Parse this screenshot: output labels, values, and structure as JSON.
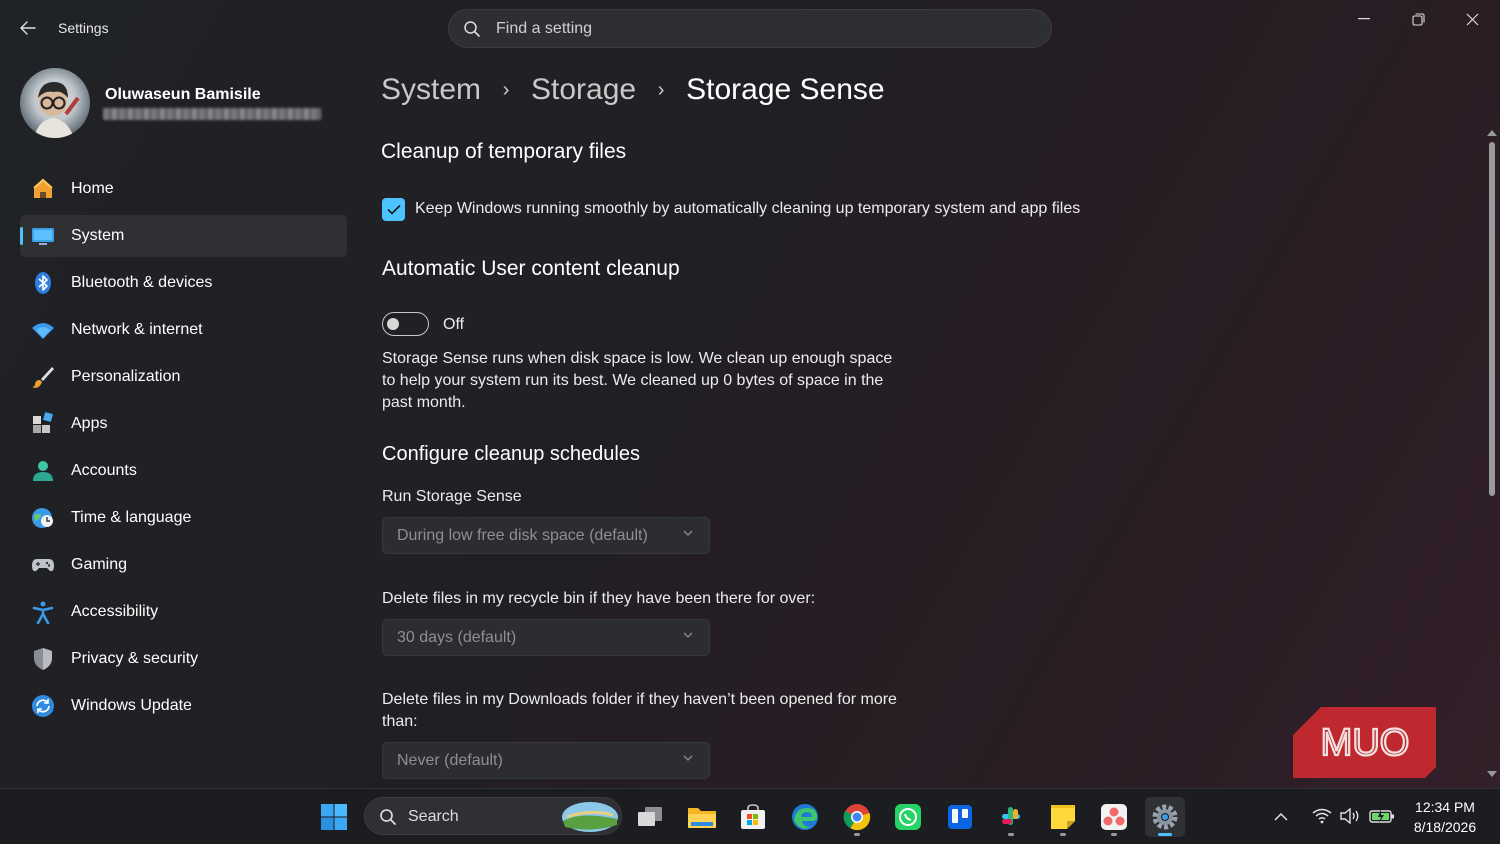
{
  "app": {
    "title": "Settings",
    "search_placeholder": "Find a setting"
  },
  "profile": {
    "name": "Oluwaseun Bamisile"
  },
  "sidebar": {
    "items": [
      {
        "label": "Home",
        "icon": "home-icon"
      },
      {
        "label": "System",
        "icon": "system-icon",
        "active": true
      },
      {
        "label": "Bluetooth & devices",
        "icon": "bluetooth-icon"
      },
      {
        "label": "Network & internet",
        "icon": "wifi-icon"
      },
      {
        "label": "Personalization",
        "icon": "brush-icon"
      },
      {
        "label": "Apps",
        "icon": "apps-icon"
      },
      {
        "label": "Accounts",
        "icon": "account-icon"
      },
      {
        "label": "Time & language",
        "icon": "globe-clock-icon"
      },
      {
        "label": "Gaming",
        "icon": "gamepad-icon"
      },
      {
        "label": "Accessibility",
        "icon": "accessibility-icon"
      },
      {
        "label": "Privacy & security",
        "icon": "shield-icon"
      },
      {
        "label": "Windows Update",
        "icon": "update-icon"
      }
    ]
  },
  "breadcrumb": {
    "items": [
      "System",
      "Storage",
      "Storage Sense"
    ],
    "separator": "›"
  },
  "content": {
    "cleanup_heading": "Cleanup of temporary files",
    "cleanup_checkbox_label": "Keep Windows running smoothly by automatically cleaning up temporary system and app files",
    "cleanup_checked": true,
    "auto_heading": "Automatic User content cleanup",
    "toggle_state": "Off",
    "description": "Storage Sense runs when disk space is low. We clean up enough space to help your system run its best. We cleaned up 0 bytes of space in the past month.",
    "schedules_heading": "Configure cleanup schedules",
    "run_label": "Run Storage Sense",
    "run_value": "During low free disk space (default)",
    "recycle_label": "Delete files in my recycle bin if they have been there for over:",
    "recycle_value": "30 days (default)",
    "downloads_label": "Delete files in my Downloads folder if they haven’t been opened for more than:",
    "downloads_value": "Never (default)"
  },
  "watermark": {
    "text": "MUO"
  },
  "taskbar": {
    "search_label": "Search",
    "apps": [
      "start-icon",
      "task-view-icon",
      "file-explorer-icon",
      "store-icon",
      "edge-icon",
      "chrome-icon",
      "whatsapp-icon",
      "trello-icon",
      "slack-icon",
      "sticky-notes-icon",
      "asana-icon",
      "settings-icon"
    ],
    "time": "12:34 PM",
    "date": "8/18/2026"
  },
  "colors": {
    "accent": "#4cc2ff",
    "watermark": "#c0282f"
  }
}
